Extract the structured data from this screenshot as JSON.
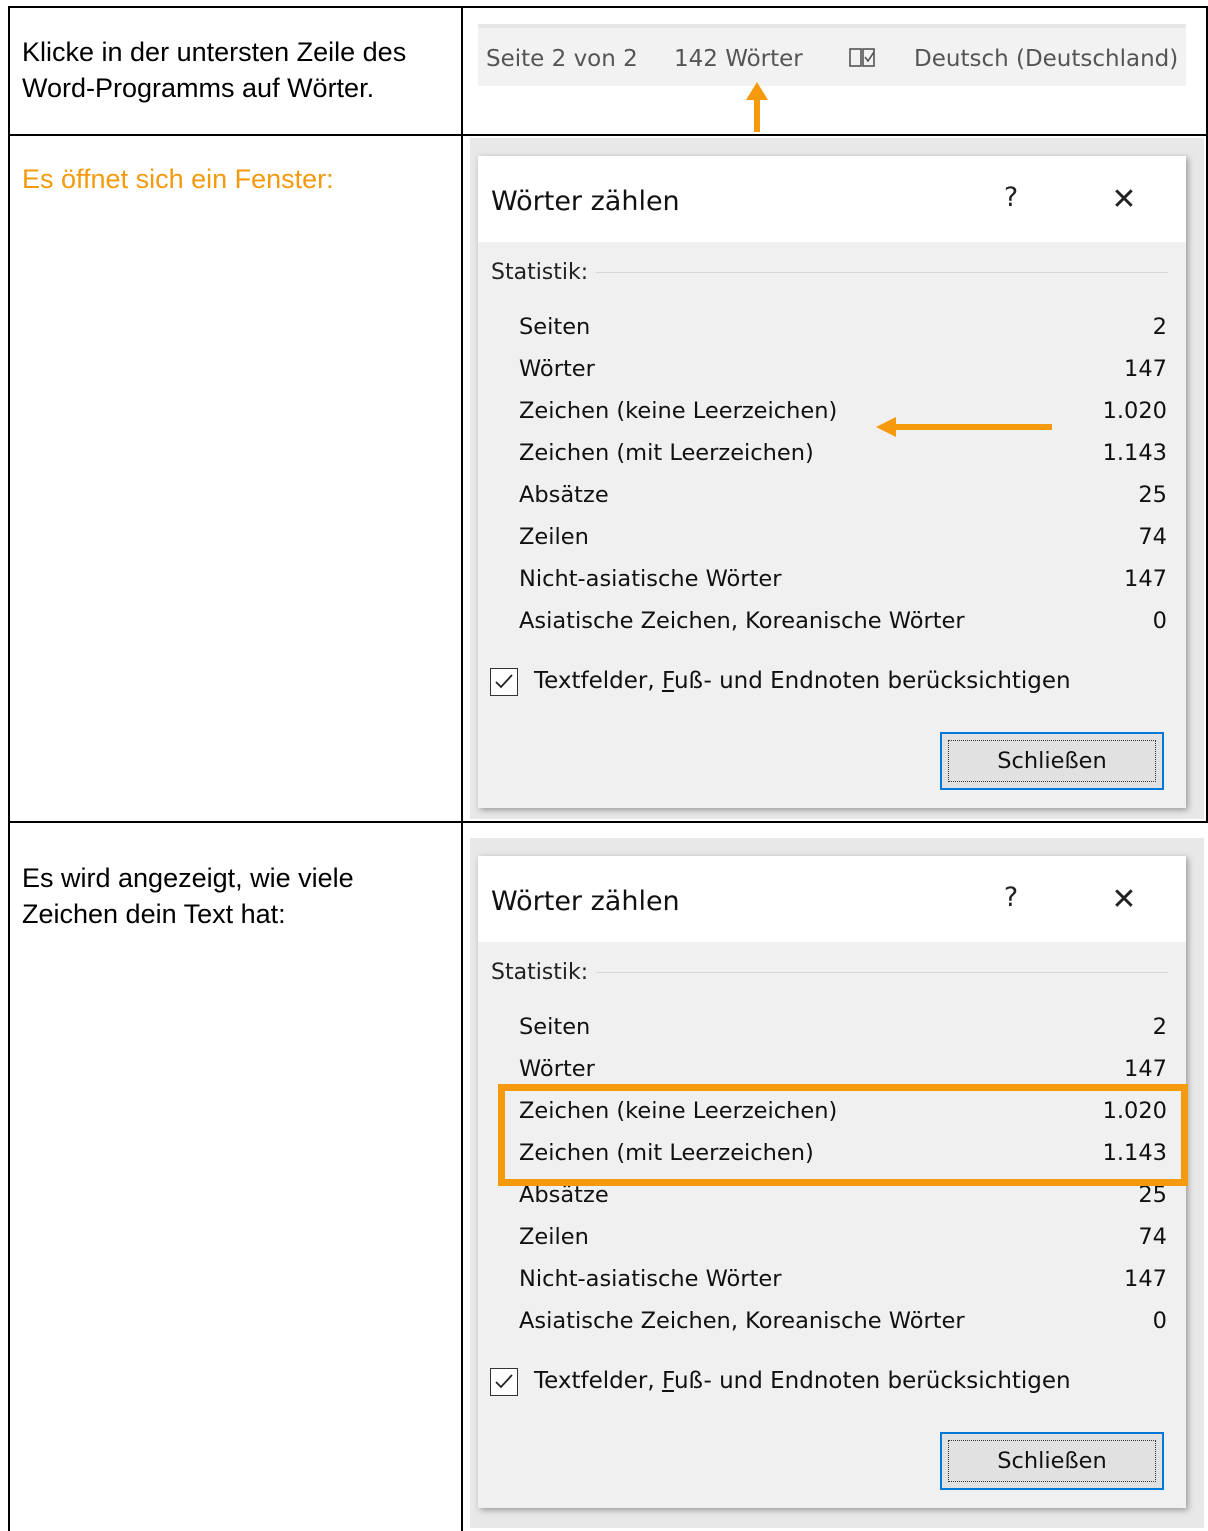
{
  "instructions": [
    {
      "text": "Klicke in der untersten Zeile des Word-Programms auf Wörter."
    },
    {
      "text": "Es öffnet sich ein Fenster:"
    },
    {
      "text": "Es wird angezeigt, wie viele Zeichen dein Text hat:"
    }
  ],
  "statusbar": {
    "page_info": "Seite 2 von 2",
    "word_count": "142 Wörter",
    "proofing_icon": "book-check-icon",
    "language": "Deutsch (Deutschland)"
  },
  "dialog": {
    "title": "Wörter zählen",
    "help_label": "?",
    "close_symbol": "✕",
    "section_label": "Statistik:",
    "stats": [
      {
        "label": "Seiten",
        "value": "2"
      },
      {
        "label": "Wörter",
        "value": "147"
      },
      {
        "label": "Zeichen (keine Leerzeichen)",
        "value": "1.020"
      },
      {
        "label": "Zeichen (mit Leerzeichen)",
        "value": "1.143"
      },
      {
        "label": "Absätze",
        "value": "25"
      },
      {
        "label": "Zeilen",
        "value": "74"
      },
      {
        "label": "Nicht-asiatische Wörter",
        "value": "147"
      },
      {
        "label": "Asiatische Zeichen, Koreanische Wörter",
        "value": "0"
      }
    ],
    "checkbox": {
      "checked": true,
      "label_before": "Textfelder, ",
      "label_accel": "F",
      "label_after": "uß- und Endnoten berücksichtigen"
    },
    "close_button_label": "Schließen"
  },
  "colors": {
    "accent": "#f59a0c",
    "button_focus": "#0078d7"
  }
}
